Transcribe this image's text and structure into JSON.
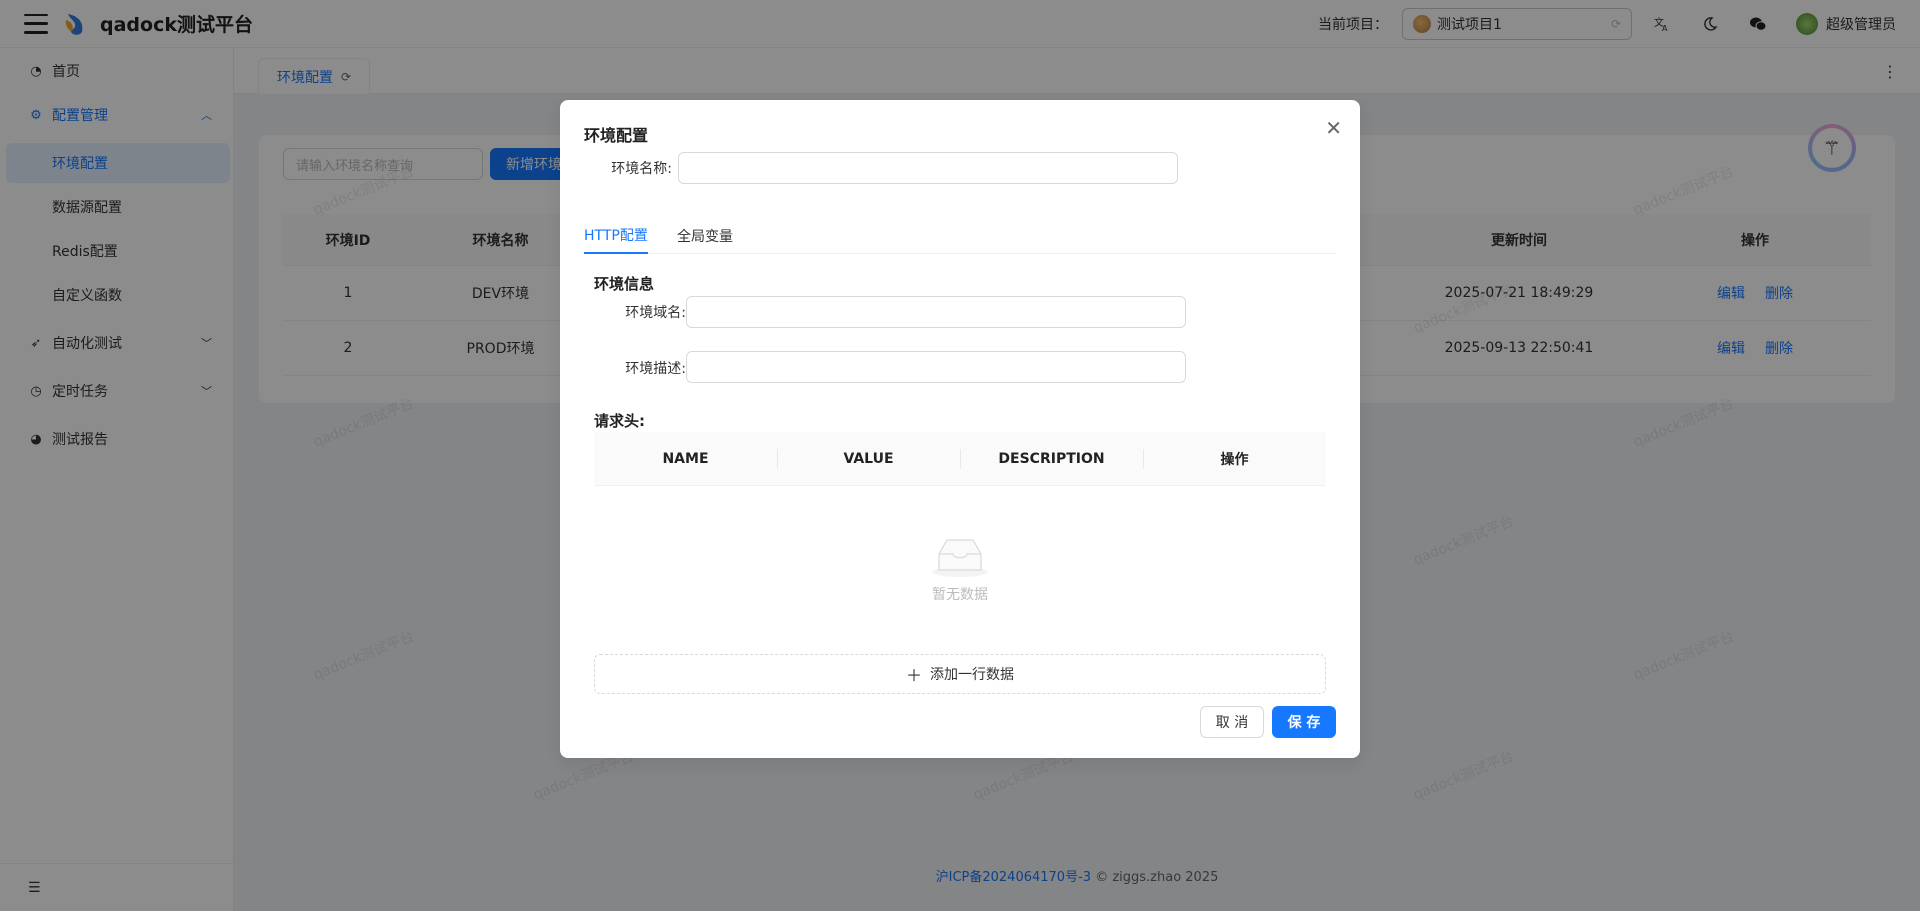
{
  "app": {
    "title": "qadock测试平台"
  },
  "header": {
    "project_label": "当前项目：",
    "project_name": "测试项目1",
    "user_name": "超级管理员"
  },
  "sidebar": {
    "home": "首页",
    "config": "配置管理",
    "config_children": [
      "环境配置",
      "数据源配置",
      "Redis配置",
      "自定义函数"
    ],
    "autotest": "自动化测试",
    "scheduled": "定时任务",
    "reports": "测试报告"
  },
  "tabbar": {
    "tab_label": "环境配置"
  },
  "page": {
    "search_placeholder": "请输入环境名称查询",
    "add_button": "新增环境",
    "columns": {
      "id": "环境ID",
      "name": "环境名称",
      "updated": "更新时间",
      "actions": "操作"
    },
    "rows": [
      {
        "id": "1",
        "name": "DEV环境",
        "updated": "2025-07-21 18:49:29",
        "edit": "编辑",
        "delete": "删除"
      },
      {
        "id": "2",
        "name": "PROD环境",
        "updated": "2025-09-13 22:50:41",
        "edit": "编辑",
        "delete": "删除"
      }
    ]
  },
  "footer": {
    "icp": "沪ICP备2024064170号-3",
    "copyright": "© ziggs.zhao 2025"
  },
  "watermark": "qadock测试平台",
  "modal": {
    "title": "环境配置",
    "env_name_label": "环境名称:",
    "tabs": [
      "HTTP配置",
      "全局变量"
    ],
    "env_info_title": "环境信息",
    "domain_label": "环境域名:",
    "desc_label": "环境描述:",
    "headers_title": "请求头:",
    "header_columns": [
      "NAME",
      "VALUE",
      "DESCRIPTION",
      "操作"
    ],
    "empty_text": "暂无数据",
    "add_row": "添加一行数据",
    "cancel": "取 消",
    "save": "保 存"
  },
  "colors": {
    "primary": "#1677ff",
    "mask": "rgba(0,0,0,0.45)"
  }
}
